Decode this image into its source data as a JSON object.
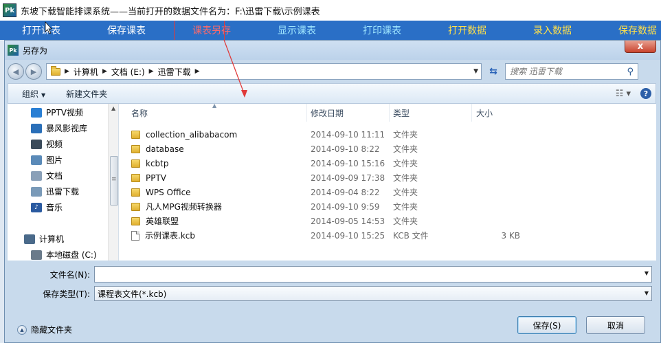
{
  "app": {
    "logo_text": "Pk",
    "title": "东坡下载智能排课系统——当前打开的数据文件名为：F:\\迅雷下载\\示例课表"
  },
  "app_menu": [
    {
      "label": "打开课表"
    },
    {
      "label": "保存课表"
    },
    {
      "label": "课表另存"
    },
    {
      "label": "显示课表"
    },
    {
      "label": "打印课表"
    },
    {
      "label": "打开数据"
    },
    {
      "label": "录入数据"
    },
    {
      "label": "保存数据"
    }
  ],
  "dialog": {
    "title": "另存为",
    "close_label": "x",
    "breadcrumb": [
      "计算机",
      "文档 (E:)",
      "迅雷下载"
    ],
    "search_placeholder": "搜索 迅雷下载",
    "toolbar": {
      "organize": "组织",
      "new_folder": "新建文件夹"
    },
    "nav": [
      {
        "label": "PPTV视频",
        "icon": "pptv-icon",
        "color": "#2a7fd4"
      },
      {
        "label": "暴风影视库",
        "icon": "video-library-icon",
        "color": "#2a6fb8"
      },
      {
        "label": "视频",
        "icon": "video-icon",
        "color": "#3a4a5a"
      },
      {
        "label": "图片",
        "icon": "picture-icon",
        "color": "#5a8ab8"
      },
      {
        "label": "文档",
        "icon": "document-icon",
        "color": "#8aa0b8"
      },
      {
        "label": "迅雷下载",
        "icon": "thunder-download-icon",
        "color": "#7a9ab8"
      },
      {
        "label": "音乐",
        "icon": "music-icon",
        "color": "#2a5aa0"
      },
      {
        "label": "计算机",
        "icon": "computer-icon",
        "color": "#4a6a8a"
      },
      {
        "label": "本地磁盘 (C:)",
        "icon": "disk-icon",
        "color": "#6a7a8a"
      }
    ],
    "columns": [
      "名称",
      "修改日期",
      "类型",
      "大小"
    ],
    "files": [
      {
        "name": "collection_alibabacom",
        "date": "2014-09-10 11:11",
        "type": "文件夹",
        "size": "",
        "kind": "folder"
      },
      {
        "name": "database",
        "date": "2014-09-10 8:22",
        "type": "文件夹",
        "size": "",
        "kind": "folder"
      },
      {
        "name": "kcbtp",
        "date": "2014-09-10 15:16",
        "type": "文件夹",
        "size": "",
        "kind": "folder"
      },
      {
        "name": "PPTV",
        "date": "2014-09-09 17:38",
        "type": "文件夹",
        "size": "",
        "kind": "folder"
      },
      {
        "name": "WPS Office",
        "date": "2014-09-04 8:22",
        "type": "文件夹",
        "size": "",
        "kind": "folder"
      },
      {
        "name": "凡人MPG视频转换器",
        "date": "2014-09-10 9:59",
        "type": "文件夹",
        "size": "",
        "kind": "folder"
      },
      {
        "name": "英雄联盟",
        "date": "2014-09-05 14:53",
        "type": "文件夹",
        "size": "",
        "kind": "folder"
      },
      {
        "name": "示例课表.kcb",
        "date": "2014-09-10 15:25",
        "type": "KCB 文件",
        "size": "3 KB",
        "kind": "file"
      }
    ],
    "filename_label": "文件名(N):",
    "filename_value": "",
    "filetype_label": "保存类型(T):",
    "filetype_value": "课程表文件(*.kcb)",
    "hide_folders": "隐藏文件夹",
    "save_button": "保存(S)",
    "cancel_button": "取消"
  },
  "colors": {
    "menu_bg": "#2a6fc6",
    "annotation_red": "#e03a3a"
  }
}
